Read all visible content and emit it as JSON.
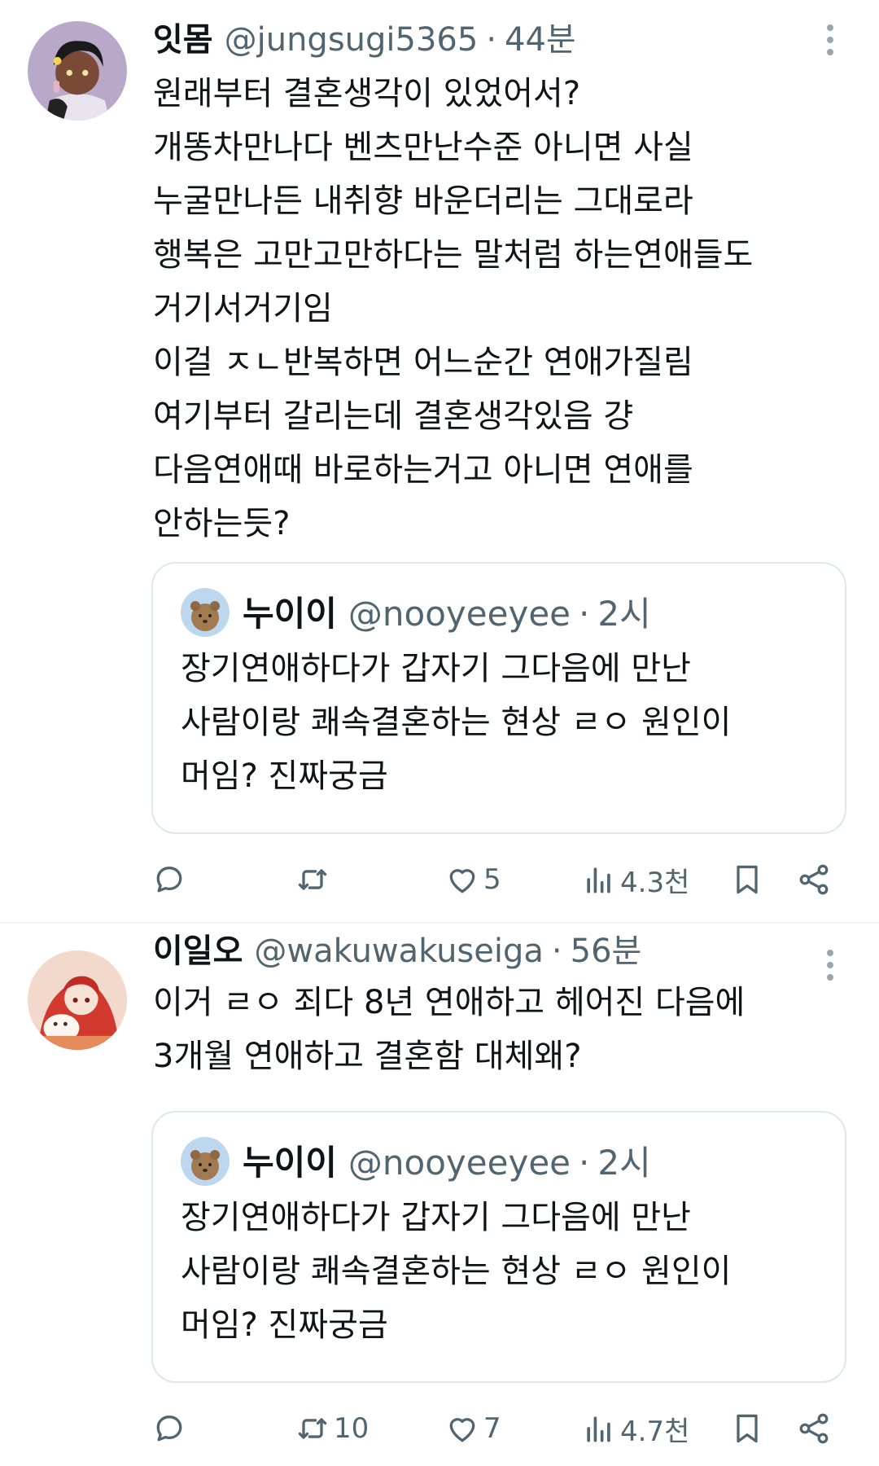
{
  "colors": {
    "text_primary": "#0f1419",
    "text_secondary": "#536471",
    "border": "#e1e6ea",
    "separator": "#eff3f4"
  },
  "tweets": [
    {
      "author": {
        "name": "잇몸",
        "handle": "@jungsugi5365",
        "avatar_icon": "user-avatar-illustration"
      },
      "time": "44분",
      "separator": "·",
      "text_lines": [
        "원래부터 결혼생각이 있었어서?",
        "개똥차만나다 벤츠만난수준 아니면 사실",
        "누굴만나든 내취향 바운더리는 그대로라",
        "행복은 고만고만하다는 말처럼 하는연애들도",
        "거기서거기임",
        "이걸 ㅈㄴ반복하면 어느순간 연애가질림",
        "여기부터 갈리는데 결혼생각있음 걍",
        "다음연애때 바로하는거고 아니면 연애를",
        "안하는듯?"
      ],
      "quote": {
        "author": {
          "name": "누이이",
          "handle": "@nooyeeyee",
          "avatar_icon": "quokka-avatar"
        },
        "time": "2시",
        "separator": "·",
        "text_lines": [
          "장기연애하다가 갑자기 그다음에 만난",
          "사람이랑 쾌속결혼하는 현상 ㄹㅇ 원인이",
          "머임? 진짜궁금"
        ]
      },
      "actions": {
        "reply": {
          "icon": "reply-icon",
          "count": ""
        },
        "retweet": {
          "icon": "retweet-icon",
          "count": ""
        },
        "like": {
          "icon": "heart-icon",
          "count": "5"
        },
        "views": {
          "icon": "views-icon",
          "count": "4.3천"
        },
        "bookmark": {
          "icon": "bookmark-icon"
        },
        "share": {
          "icon": "share-icon"
        }
      }
    },
    {
      "author": {
        "name": "이일오",
        "handle": "@wakuwakuseiga",
        "avatar_icon": "anime-girl-avatar"
      },
      "time": "56분",
      "separator": "·",
      "text_lines": [
        "이거 ㄹㅇ 죄다 8년 연애하고 헤어진 다음에",
        "3개월 연애하고 결혼함 대체왜?"
      ],
      "quote": {
        "author": {
          "name": "누이이",
          "handle": "@nooyeeyee",
          "avatar_icon": "quokka-avatar"
        },
        "time": "2시",
        "separator": "·",
        "text_lines": [
          "장기연애하다가 갑자기 그다음에 만난",
          "사람이랑 쾌속결혼하는 현상 ㄹㅇ 원인이",
          "머임? 진짜궁금"
        ]
      },
      "actions": {
        "reply": {
          "icon": "reply-icon",
          "count": ""
        },
        "retweet": {
          "icon": "retweet-icon",
          "count": "10"
        },
        "like": {
          "icon": "heart-icon",
          "count": "7"
        },
        "views": {
          "icon": "views-icon",
          "count": "4.7천"
        },
        "bookmark": {
          "icon": "bookmark-icon"
        },
        "share": {
          "icon": "share-icon"
        }
      }
    }
  ]
}
